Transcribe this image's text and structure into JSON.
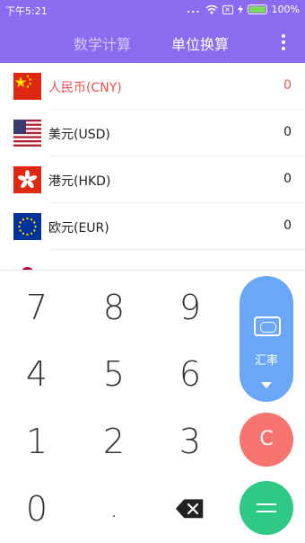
{
  "status_bar": {
    "time": "下午5:21",
    "dots": "...",
    "x_icon": "×",
    "battery_text": "100%"
  },
  "tabs": [
    {
      "label": "数学计算",
      "active": false
    },
    {
      "label": "单位换算",
      "active": true
    }
  ],
  "currencies": [
    {
      "name": "人民币(CNY)",
      "amount": "0",
      "selected": true,
      "flag": "china-flag-icon"
    },
    {
      "name": "美元(USD)",
      "amount": "0",
      "selected": false,
      "flag": "usa-flag-icon"
    },
    {
      "name": "港元(HKD)",
      "amount": "0",
      "selected": false,
      "flag": "hong-kong-flag-icon"
    },
    {
      "name": "欧元(EUR)",
      "amount": "0",
      "selected": false,
      "flag": "eu-flag-icon"
    }
  ],
  "keypad": {
    "keys": [
      "7",
      "8",
      "9",
      "4",
      "5",
      "6",
      "1",
      "2",
      "3",
      "0",
      "."
    ],
    "rate_label": "汇率",
    "clear_label": "C"
  },
  "colors": {
    "header": "#8b6cf0",
    "selected_text": "#f0504b",
    "rate_button": "#6aa7f6",
    "clear_button": "#f77471",
    "equal_button": "#2fc986"
  }
}
